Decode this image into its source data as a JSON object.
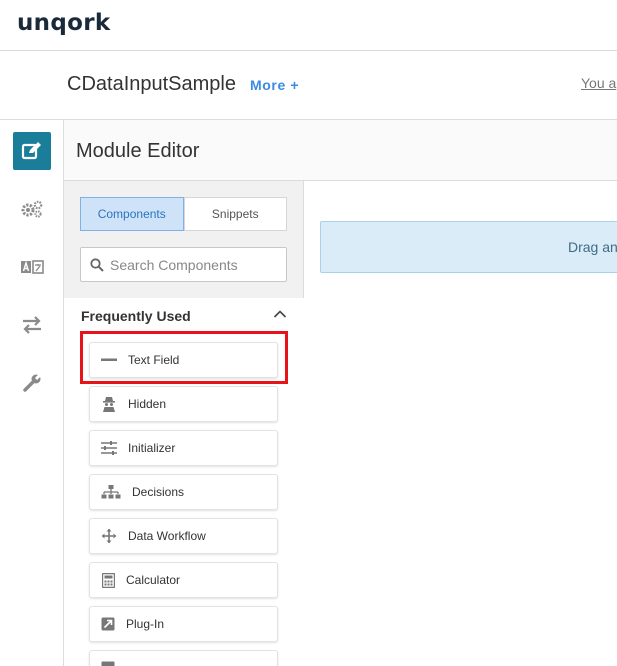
{
  "brand": {
    "logo": "unqork"
  },
  "header": {
    "app_title": "CDataInputSample",
    "more_label": "More +",
    "user_text": "You a"
  },
  "leftnav": {
    "items": [
      {
        "icon": "edit-icon",
        "active": true
      },
      {
        "icon": "gears-icon",
        "active": false
      },
      {
        "icon": "translate-icon",
        "active": false
      },
      {
        "icon": "swap-arrows-icon",
        "active": false
      },
      {
        "icon": "wrench-icon",
        "active": false
      }
    ]
  },
  "editor": {
    "title": "Module Editor"
  },
  "panel": {
    "tabs": [
      {
        "label": "Components",
        "active": true
      },
      {
        "label": "Snippets",
        "active": false
      }
    ],
    "search": {
      "placeholder": "Search Components",
      "value": ""
    },
    "section": {
      "title": "Frequently Used"
    },
    "components": [
      {
        "label": "Text Field",
        "icon": "text-field-icon"
      },
      {
        "label": "Hidden",
        "icon": "hidden-spy-icon"
      },
      {
        "label": "Initializer",
        "icon": "sliders-icon"
      },
      {
        "label": "Decisions",
        "icon": "sitemap-icon"
      },
      {
        "label": "Data Workflow",
        "icon": "move-arrows-icon"
      },
      {
        "label": "Calculator",
        "icon": "calculator-icon"
      },
      {
        "label": "Plug-In",
        "icon": "plug-in-icon"
      },
      {
        "label": "",
        "icon": "list-icon"
      }
    ]
  },
  "canvas": {
    "drop_text": "Drag and"
  },
  "colors": {
    "accent": "#1a7e9b",
    "link": "#3d8be0",
    "tab_active_bg": "#cfe3f8",
    "highlight": "#e8121b",
    "dropzone_bg": "#d9ecf7"
  }
}
